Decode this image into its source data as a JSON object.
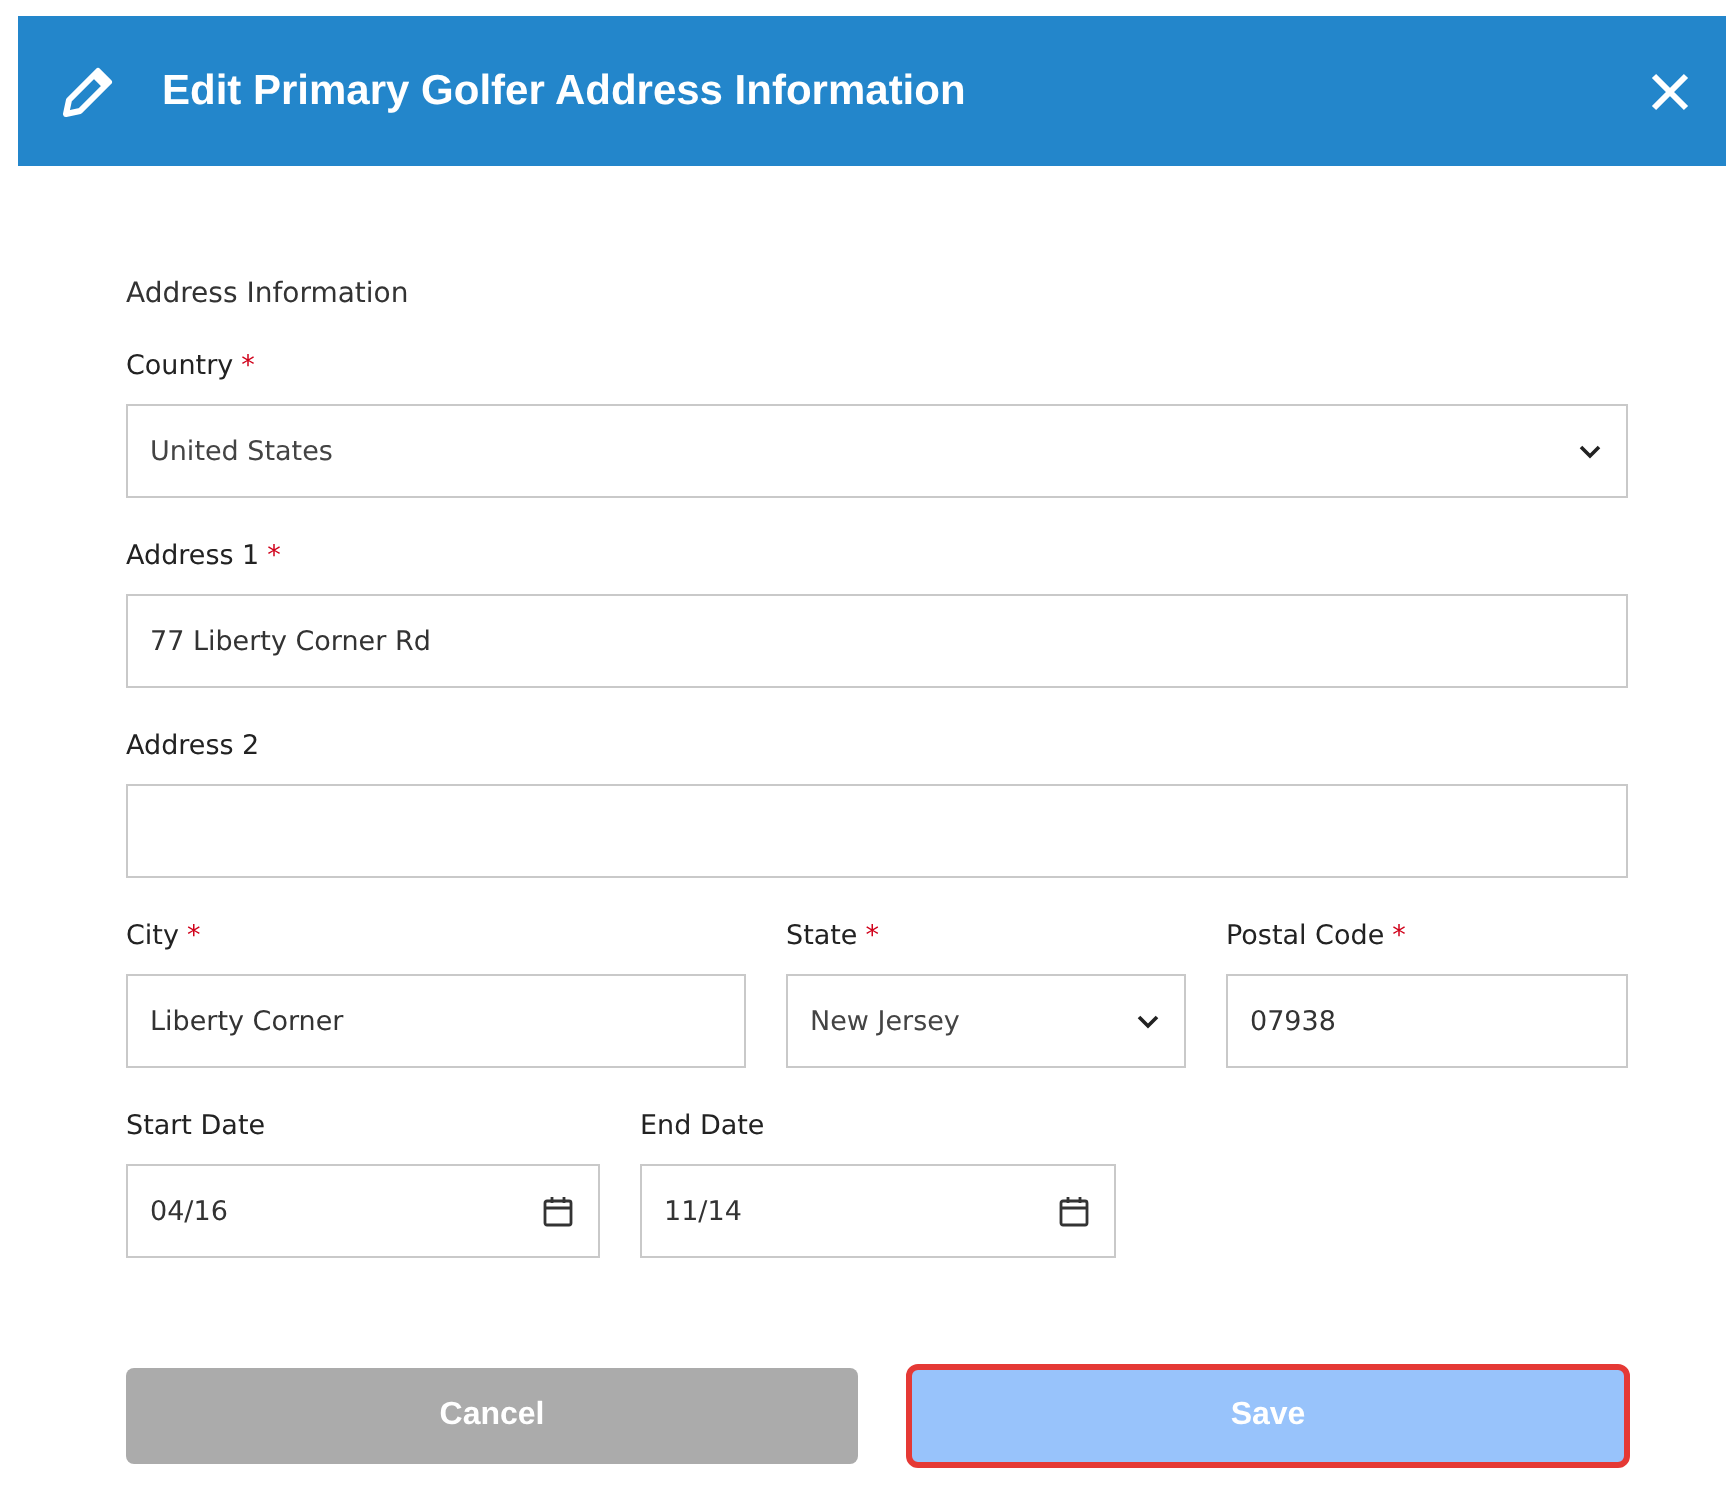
{
  "dialog": {
    "title": "Edit Primary Golfer Address Information"
  },
  "section_title": "Address Information",
  "rows": [
    [
      {
        "label": "Country",
        "required_mark": "*",
        "kind": "select",
        "value": "United States"
      }
    ],
    [
      {
        "label": "Address 1",
        "required_mark": "*",
        "kind": "text",
        "value": "77 Liberty Corner Rd"
      }
    ],
    [
      {
        "label": "Address 2",
        "kind": "text"
      }
    ],
    [
      {
        "label": "City",
        "required_mark": "*",
        "kind": "text",
        "value": "Liberty Corner"
      },
      {
        "label": "State",
        "required_mark": "*",
        "kind": "select",
        "value": "New Jersey"
      },
      {
        "label": "Postal Code",
        "required_mark": "*",
        "kind": "text",
        "value": "07938"
      }
    ],
    [
      {
        "label": "Start Date",
        "kind": "date",
        "value": "04/16"
      },
      {
        "label": "End Date",
        "kind": "date",
        "value": "11/14"
      }
    ]
  ],
  "buttons": [
    {
      "label": "Cancel",
      "kind": "secondary",
      "disabled": false,
      "highlighted": false
    },
    {
      "label": "Save",
      "kind": "primary",
      "disabled": true,
      "highlighted": true
    }
  ]
}
